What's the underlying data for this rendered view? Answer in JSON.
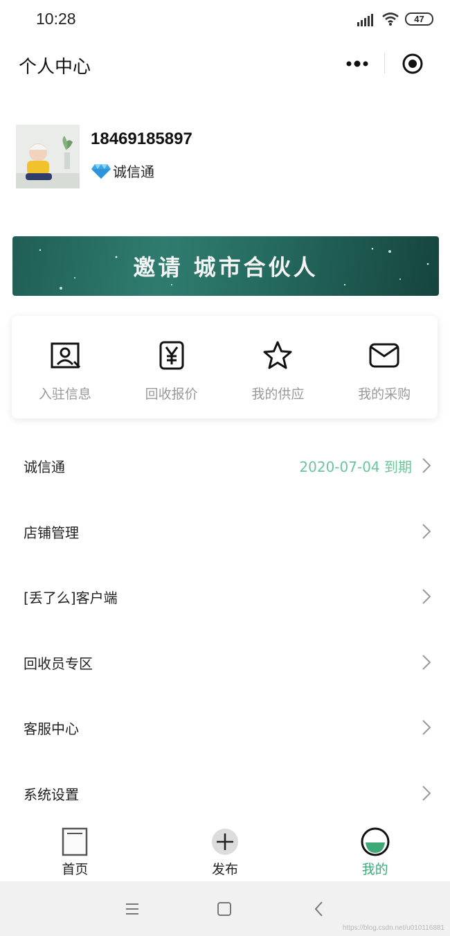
{
  "status_bar": {
    "time": "10:28",
    "battery": "47"
  },
  "title_bar": {
    "title": "个人中心"
  },
  "profile": {
    "phone": "18469185897",
    "member_label": "诚信通"
  },
  "banner": {
    "text": "邀请 城市合伙人"
  },
  "quick_actions": [
    {
      "label": "入驻信息",
      "icon": "id-card-icon"
    },
    {
      "label": "回收报价",
      "icon": "yen-icon"
    },
    {
      "label": "我的供应",
      "icon": "star-icon"
    },
    {
      "label": "我的采购",
      "icon": "mail-icon"
    }
  ],
  "menu": [
    {
      "label": "诚信通",
      "value": "2020-07-04 到期"
    },
    {
      "label": "店铺管理"
    },
    {
      "label": "[丢了么]客户端"
    },
    {
      "label": "回收员专区"
    },
    {
      "label": "客服中心"
    },
    {
      "label": "系统设置"
    }
  ],
  "tab_bar": {
    "items": [
      {
        "label": "首页",
        "icon": "home-icon"
      },
      {
        "label": "发布",
        "icon": "plus-icon"
      },
      {
        "label": "我的",
        "icon": "smile-icon",
        "active": true
      }
    ]
  },
  "watermark": "https://blog.csdn.net/u010116881",
  "colors": {
    "accent": "#3ea877",
    "expiry": "#6cc49b",
    "banner": "#256a5f"
  }
}
